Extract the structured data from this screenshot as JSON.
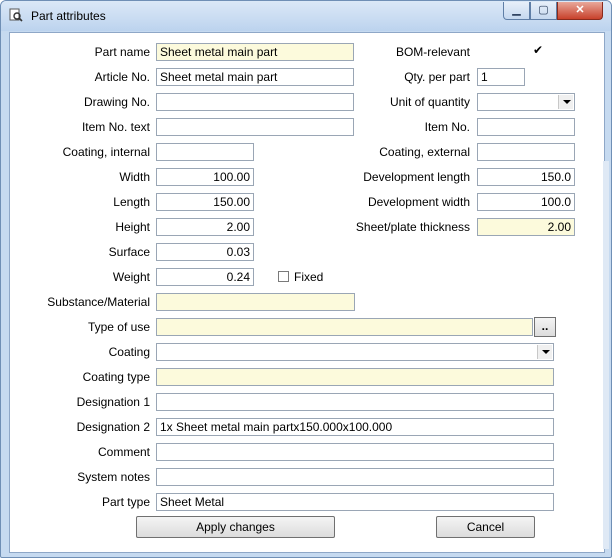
{
  "window": {
    "title": "Part attributes",
    "icon": "magnifier-document-icon"
  },
  "fields": {
    "part_name": {
      "label": "Part name",
      "value": "Sheet metal main part"
    },
    "article_no": {
      "label": "Article No.",
      "value": "Sheet metal main part"
    },
    "drawing_no": {
      "label": "Drawing No.",
      "value": ""
    },
    "item_no_text": {
      "label": "Item No. text",
      "value": ""
    },
    "coating_internal": {
      "label": "Coating, internal",
      "value": ""
    },
    "width": {
      "label": "Width",
      "value": "100.00"
    },
    "length": {
      "label": "Length",
      "value": "150.00"
    },
    "height": {
      "label": "Height",
      "value": "2.00"
    },
    "surface": {
      "label": "Surface",
      "value": "0.03"
    },
    "weight": {
      "label": "Weight",
      "value": "0.24"
    },
    "fixed": {
      "label": "Fixed",
      "checked": false
    },
    "bom_relevant": {
      "label": "BOM-relevant",
      "checked": true,
      "mark": "✔"
    },
    "qty_per_part": {
      "label": "Qty. per part",
      "value": "1"
    },
    "unit_of_quantity": {
      "label": "Unit of quantity",
      "value": ""
    },
    "item_no": {
      "label": "Item No.",
      "value": ""
    },
    "coating_external": {
      "label": "Coating, external",
      "value": ""
    },
    "development_length": {
      "label": "Development length",
      "value": "150.0"
    },
    "development_width": {
      "label": "Development width",
      "value": "100.0"
    },
    "sheet_thickness": {
      "label": "Sheet/plate thickness",
      "value": "2.00"
    },
    "substance_material": {
      "label": "Substance/Material",
      "value": ""
    },
    "type_of_use": {
      "label": "Type of use",
      "value": "",
      "browse_label": ".."
    },
    "coating": {
      "label": "Coating",
      "value": ""
    },
    "coating_type": {
      "label": "Coating type",
      "value": ""
    },
    "designation_1": {
      "label": "Designation 1",
      "value": ""
    },
    "designation_2": {
      "label": "Designation 2",
      "value": "1x Sheet metal main partx150.000x100.000"
    },
    "comment": {
      "label": "Comment",
      "value": ""
    },
    "system_notes": {
      "label": "System notes",
      "value": ""
    },
    "part_type": {
      "label": "Part type",
      "value": "Sheet Metal"
    }
  },
  "buttons": {
    "apply": "Apply changes",
    "cancel": "Cancel"
  },
  "colors": {
    "required_field": "#fcfadc",
    "window_frame": "#c6daf0"
  }
}
